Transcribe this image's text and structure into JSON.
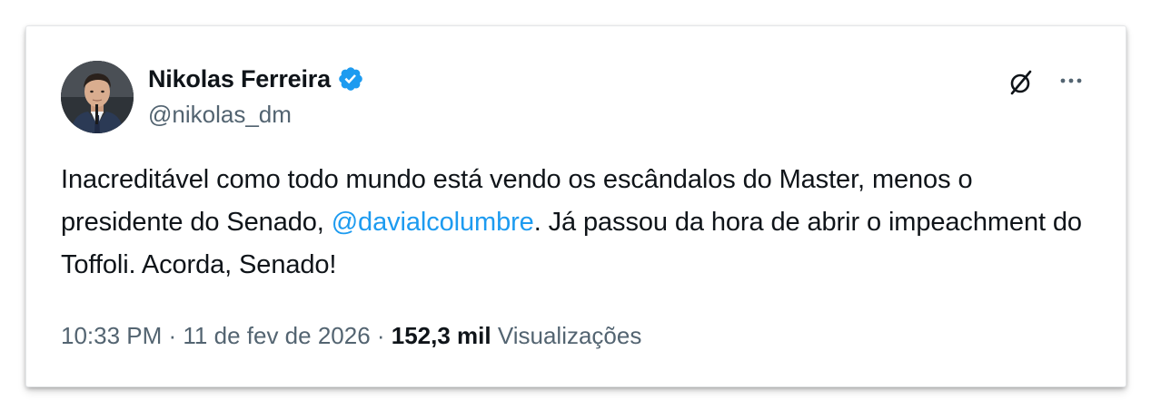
{
  "author": {
    "display_name": "Nikolas Ferreira",
    "handle": "@nikolas_dm",
    "verified": true,
    "verified_color": "#1d9bf0"
  },
  "header_actions": {
    "grok_icon": "slashed-circle-icon",
    "more_icon": "more-options-icon"
  },
  "tweet": {
    "text_part1": "Inacreditável como todo mundo está vendo os escândalos do Master, menos o presidente do Senado, ",
    "mention": "@davialcolumbre",
    "text_part2": ". Já passou da hora de abrir o impeachment do Toffoli. Acorda, Senado!"
  },
  "meta": {
    "time": "10:33 PM",
    "separator1": " · ",
    "date": "11 de fev de 2026",
    "separator2": " · ",
    "views_count": "152,3 mil",
    "views_label": " Visualizações"
  },
  "colors": {
    "text_primary": "#0f1419",
    "text_secondary": "#536471",
    "link": "#1d9bf0"
  }
}
